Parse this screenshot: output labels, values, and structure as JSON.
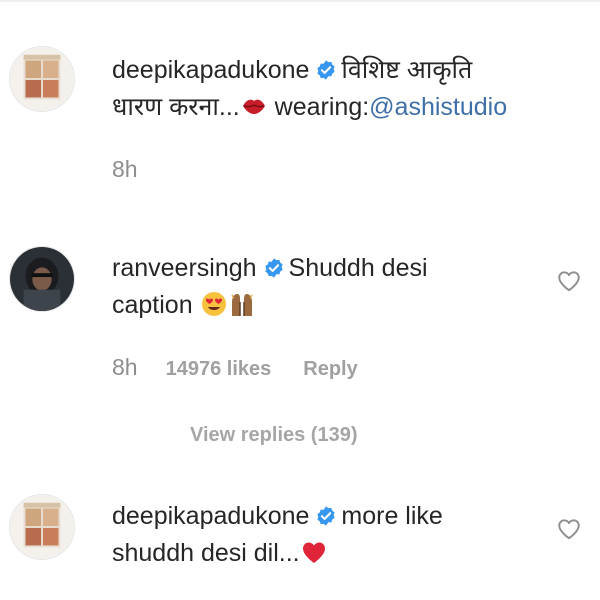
{
  "comments": [
    {
      "username": "deepikapadukone",
      "text_line1": "विशिष्ट आकृति",
      "text_line2": "धारण करना...",
      "wearing_label": "wearing:",
      "mention": "@ashistudio",
      "time": "8h"
    },
    {
      "username": "ranveersingh",
      "text_line1": "Shuddh desi",
      "text_line2": "caption",
      "time": "8h",
      "likes": "14976 likes",
      "reply_label": "Reply",
      "view_replies": "View replies (139)"
    },
    {
      "username": "deepikapadukone",
      "text_line1": "more like",
      "text_line2": "shuddh desi dil..."
    }
  ],
  "icons": {
    "verified": "verified-badge-icon",
    "heart": "heart-outline-icon",
    "lips": "kiss-mark-emoji",
    "heart_eyes": "heart-eyes-emoji",
    "hands": "raised-hands-emoji",
    "red_heart": "red-heart-emoji"
  },
  "colors": {
    "verified_blue": "#3897f0",
    "mention": "#3f6fa8",
    "secondary_text": "#8e8e8e"
  }
}
